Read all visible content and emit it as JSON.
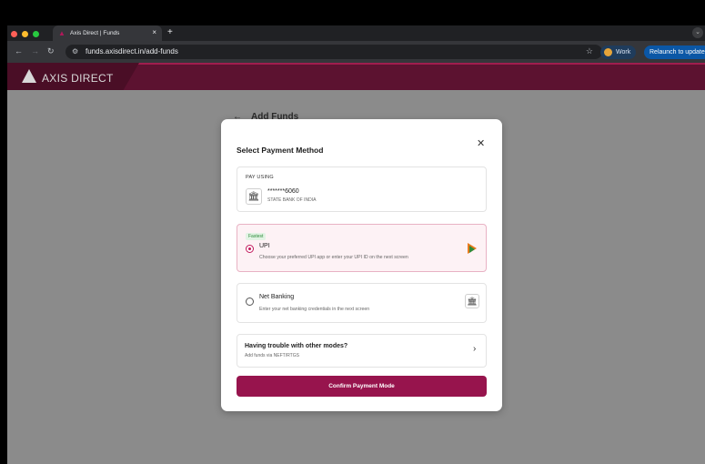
{
  "browser": {
    "tab_title": "Axis Direct | Funds",
    "tab_close": "×",
    "new_tab": "+",
    "url": "funds.axisdirect.in/add-funds",
    "profile_label": "Work",
    "relaunch_label": "Relaunch to update"
  },
  "brand": {
    "logo_text": "AXIS DIRECT"
  },
  "page": {
    "title": "Add Funds"
  },
  "modal": {
    "title": "Select Payment Method",
    "pay_using": {
      "label": "PAY USING",
      "account": "*******6060",
      "bank": "STATE BANK OF INDIA"
    },
    "options": [
      {
        "badge": "Fastest",
        "name": "UPI",
        "description": "Choose your preferred UPI app or enter your UPI ID on the next screen",
        "selected": true
      },
      {
        "name": "Net Banking",
        "description": "Enter your net banking credentials in the next screen",
        "selected": false
      }
    ],
    "help": {
      "title": "Having trouble with other modes?",
      "subtitle": "Add funds via NEFT/RTGS"
    },
    "confirm_label": "Confirm Payment Mode"
  },
  "colors": {
    "brand": "#97144d",
    "selected_bg": "#fdf2f5",
    "fastest_green": "#2e8b3a"
  }
}
